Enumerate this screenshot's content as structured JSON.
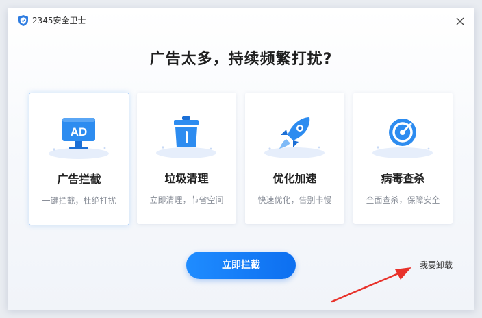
{
  "window": {
    "title": "2345安全卫士"
  },
  "headline": "广告太多，持续频繁打扰?",
  "features": [
    {
      "name": "ad-block",
      "icon": "ad-monitor-icon",
      "label": "广告拦截",
      "desc": "一键拦截，杜绝打扰",
      "selected": true
    },
    {
      "name": "junk-clean",
      "icon": "trash-bin-icon",
      "label": "垃圾清理",
      "desc": "立即清理，节省空间",
      "selected": false
    },
    {
      "name": "speed-up",
      "icon": "rocket-icon",
      "label": "优化加速",
      "desc": "快速优化，告别卡慢",
      "selected": false
    },
    {
      "name": "virus-scan",
      "icon": "radar-scan-icon",
      "label": "病毒查杀",
      "desc": "全面查杀，保障安全",
      "selected": false
    }
  ],
  "primary_button": "立即拦截",
  "uninstall_link": "我要卸载",
  "colors": {
    "accent": "#1a82fb",
    "arrow": "#e8322b",
    "card_selected_border": "#8cbcf3"
  }
}
